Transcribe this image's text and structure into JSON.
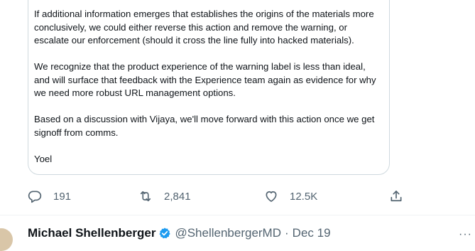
{
  "quoted_message": {
    "paragraphs": [
      "If additional information emerges that establishes the origins of the materials more conclusively, we could either reverse this action and remove the warning, or escalate our enforcement (should it cross the line fully into hacked materials).",
      "We recognize that the product experience of the warning label is less than ideal, and will surface that feedback with the Experience team again as evidence for why we need more robust URL management options.",
      "Based on a discussion with Vijaya, we'll move forward with this action once we get signoff from comms.",
      "Yoel"
    ]
  },
  "actions": {
    "reply_count": "191",
    "retweet_count": "2,841",
    "like_count": "12.5K"
  },
  "next_tweet": {
    "author_name": "Michael Shellenberger",
    "handle": "@ShellenbergerMD",
    "separator": "·",
    "date": "Dec 19",
    "more_label": "···"
  },
  "colors": {
    "text": "#0f1419",
    "secondary": "#536471",
    "border": "#cfd9de",
    "verified": "#1d9bf0"
  }
}
